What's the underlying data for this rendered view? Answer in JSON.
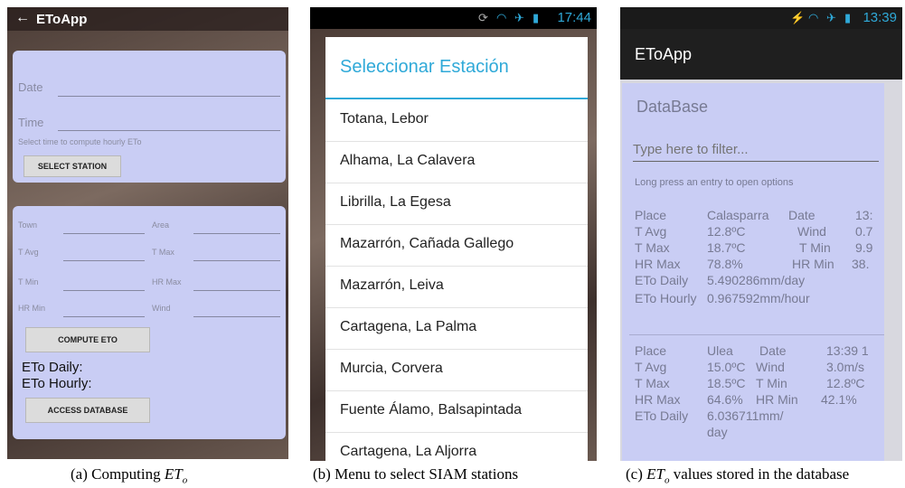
{
  "phone_a": {
    "back_icon": "arrow-left-icon",
    "app_title": "EToApp",
    "date_label": "Date",
    "time_label": "Time",
    "time_hint": "Select time to compute hourly ETo",
    "select_station_button": "SELECT STATION",
    "fields": {
      "town": "Town",
      "area": "Area",
      "t_avg": "T Avg",
      "t_max": "T Max",
      "t_min": "T Min",
      "hr_max": "HR Max",
      "hr_min": "HR Min",
      "wind": "Wind"
    },
    "compute_button": "COMPUTE ETO",
    "eto_daily": "ETo Daily:",
    "eto_hourly": "ETo Hourly:",
    "database_button": "ACCESS DATABASE"
  },
  "phone_b": {
    "status_time": "17:44",
    "dialog_title": "Seleccionar Estación",
    "stations": [
      "Totana, Lebor",
      "Alhama, La Calavera",
      "Librilla, La Egesa",
      "Mazarrón, Cañada Gallego",
      "Mazarrón, Leiva",
      "Cartagena, La Palma",
      "Murcia, Corvera",
      "Fuente Álamo, Balsapintada",
      "Cartagena, La Aljorra"
    ]
  },
  "phone_c": {
    "status_time": "13:39",
    "app_title": "EToApp",
    "section_title": "DataBase",
    "filter_placeholder": "Type here to filter...",
    "hint": "Long press an entry to open options",
    "entry1": {
      "place_label": "Place",
      "place_value": "Calasparra",
      "date_label": "Date",
      "date_value": "13:",
      "tavg_label": "T Avg",
      "tavg_value": "12.8ºC",
      "wind_label": "Wind",
      "wind_value": "0.7",
      "tmax_label": "T Max",
      "tmax_value": "18.7ºC",
      "tmin_label": "T Min",
      "tmin_value": "9.9",
      "hrmax_label": "HR Max",
      "hrmax_value": "78.8%",
      "hrmin_label": "HR Min",
      "hrmin_value": "38.",
      "daily_label": "ETo Daily",
      "daily_value": "5.490286mm/day",
      "hourly_label": "ETo Hourly",
      "hourly_value": "0.967592mm/hour"
    },
    "entry2": {
      "place_label": "Place",
      "place_value": "Ulea",
      "date_label": "Date",
      "date_value": "13:39 1",
      "tavg_label": "T Avg",
      "tavg_value": "15.0ºC",
      "wind_label": "Wind",
      "wind_value": "3.0m/s",
      "tmax_label": "T Max",
      "tmax_value": "18.5ºC",
      "tmin_label": "T Min",
      "tmin_value": "12.8ºC",
      "hrmax_label": "HR Max",
      "hrmax_value": "64.6%",
      "hrmin_label": "HR Min",
      "hrmin_value": "42.1%",
      "daily_label": "ETo Daily",
      "daily_value_line1": "6.036711mm/",
      "daily_value_line2": "day"
    }
  },
  "captions": {
    "a_prefix": "(a) Computing ",
    "a_sym": "ET",
    "a_sub": "o",
    "b": "(b)  Menu to select SIAM stations",
    "c_prefix": "(c)  ",
    "c_sym": "ET",
    "c_sub": "o",
    "c_suffix": " values stored in the database"
  }
}
